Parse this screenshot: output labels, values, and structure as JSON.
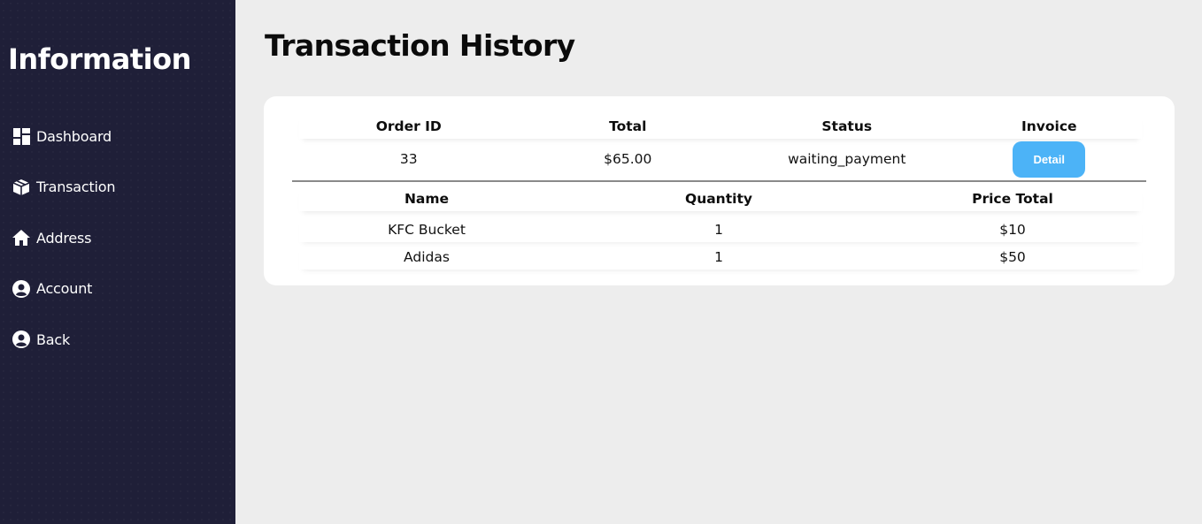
{
  "sidebar": {
    "title": "Information",
    "items": [
      {
        "label": "Dashboard",
        "icon": "dashboard-icon"
      },
      {
        "label": "Transaction",
        "icon": "box-icon"
      },
      {
        "label": "Address",
        "icon": "home-icon"
      },
      {
        "label": "Account",
        "icon": "user-circle-icon"
      },
      {
        "label": "Back",
        "icon": "user-circle-icon"
      }
    ]
  },
  "main": {
    "title": "Transaction History",
    "order_table": {
      "headers": [
        "Order ID",
        "Total",
        "Status",
        "Invoice"
      ],
      "row": {
        "order_id": "33",
        "total": "$65.00",
        "status": "waiting_payment",
        "invoice_button": "Detail"
      }
    },
    "items_table": {
      "headers": [
        "Name",
        "Quantity",
        "Price Total"
      ],
      "rows": [
        {
          "name": "KFC Bucket",
          "quantity": "1",
          "price_total": "$10"
        },
        {
          "name": "Adidas",
          "quantity": "1",
          "price_total": "$50"
        }
      ]
    }
  },
  "colors": {
    "sidebar_bg": "#1f1f38",
    "page_bg": "#ededed",
    "accent_button": "#4cb3f7"
  }
}
